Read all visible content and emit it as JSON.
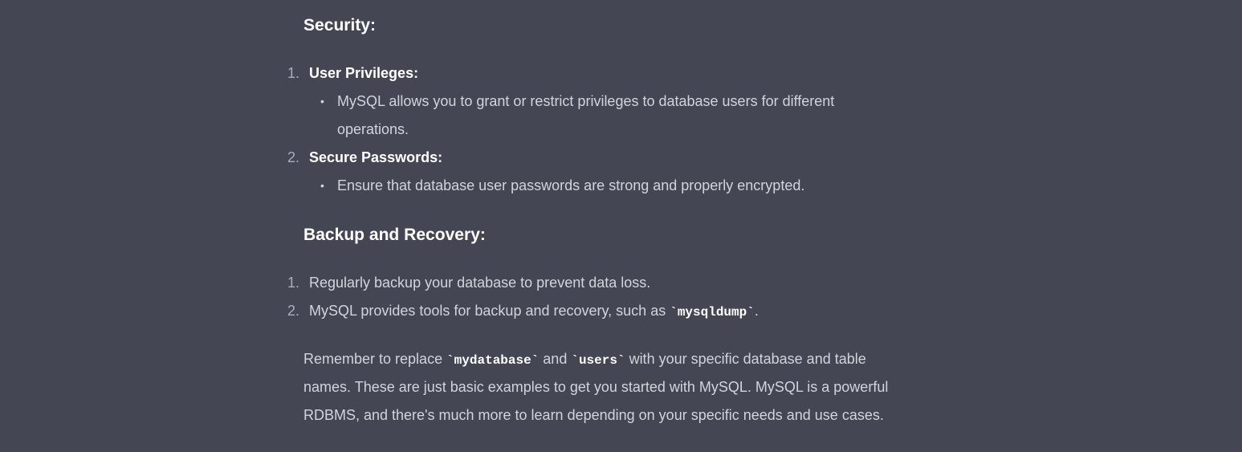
{
  "security": {
    "heading": "Security:",
    "items": [
      {
        "number": "1.",
        "title": "User Privileges:",
        "bullet_lines": [
          "MySQL allows you to grant or restrict privileges to database users for different",
          "operations."
        ]
      },
      {
        "number": "2.",
        "title": "Secure Passwords:",
        "bullet_lines": [
          "Ensure that database user passwords are strong and properly encrypted."
        ]
      }
    ]
  },
  "backup": {
    "heading": "Backup and Recovery:",
    "items": [
      {
        "number": "1.",
        "text": "Regularly backup your database to prevent data loss."
      },
      {
        "number": "2.",
        "text_before": "MySQL provides tools for backup and recovery, such as ",
        "code": "`mysqldump`",
        "text_after": "."
      }
    ]
  },
  "closing": {
    "line1_before": "Remember to replace ",
    "code1": "`mydatabase`",
    "line1_mid": " and ",
    "code2": "`users`",
    "line1_after": " with your specific database and table",
    "line2": "names. These are just basic examples to get you started with MySQL. MySQL is a powerful",
    "line3": "RDBMS, and there's much more to learn depending on your specific needs and use cases."
  }
}
